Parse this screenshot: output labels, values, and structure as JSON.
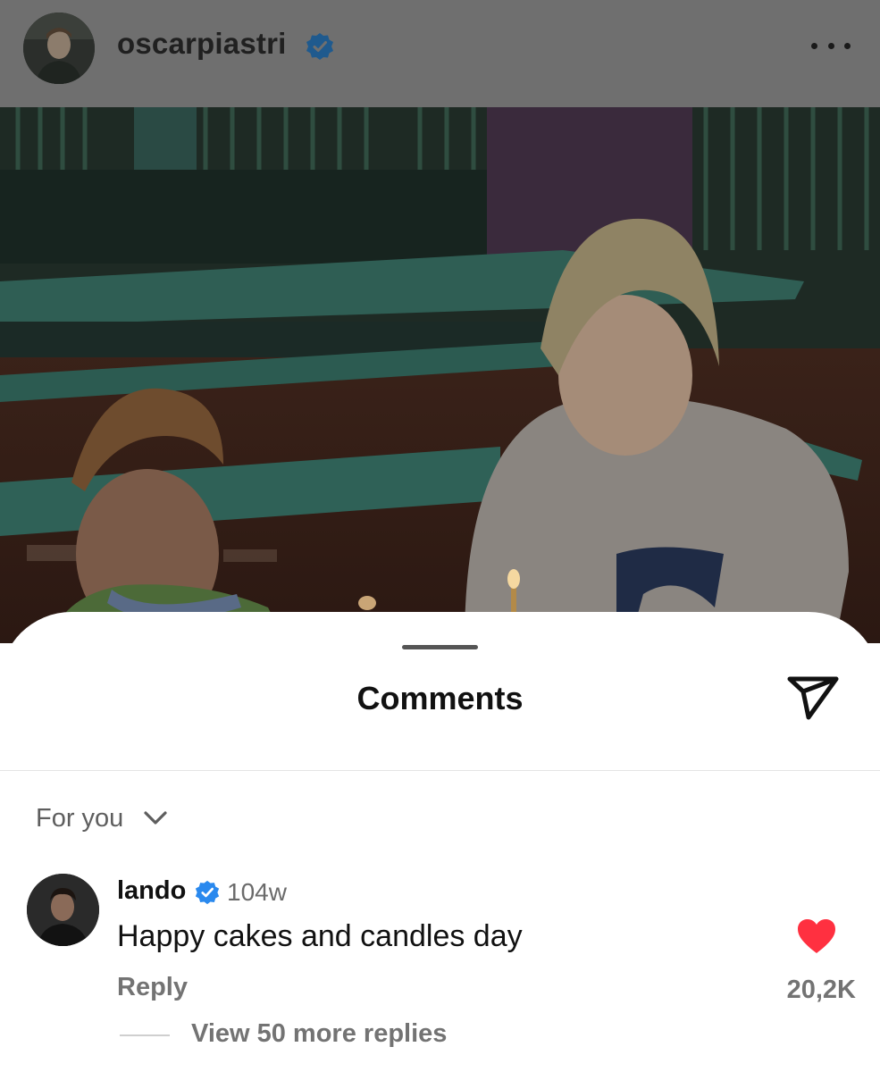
{
  "post": {
    "username": "oscarpiastri",
    "verified": true,
    "avatar_icon": "profile-photo",
    "more_icon": "more-horizontal-icon"
  },
  "comments_sheet": {
    "title": "Comments",
    "share_icon": "send-icon",
    "sort": {
      "label": "For you",
      "icon": "chevron-down-icon"
    },
    "comments": [
      {
        "author": "lando",
        "verified": true,
        "time": "104w",
        "text": "Happy cakes and candles day",
        "reply_label": "Reply",
        "liked": true,
        "like_count": "20,2K",
        "view_replies_label": "View 50 more replies"
      }
    ]
  },
  "colors": {
    "header_dim": "#6f6f6f",
    "verified_blue": "#2a89ee",
    "like_red": "#ff3040",
    "secondary_text": "#737373"
  }
}
